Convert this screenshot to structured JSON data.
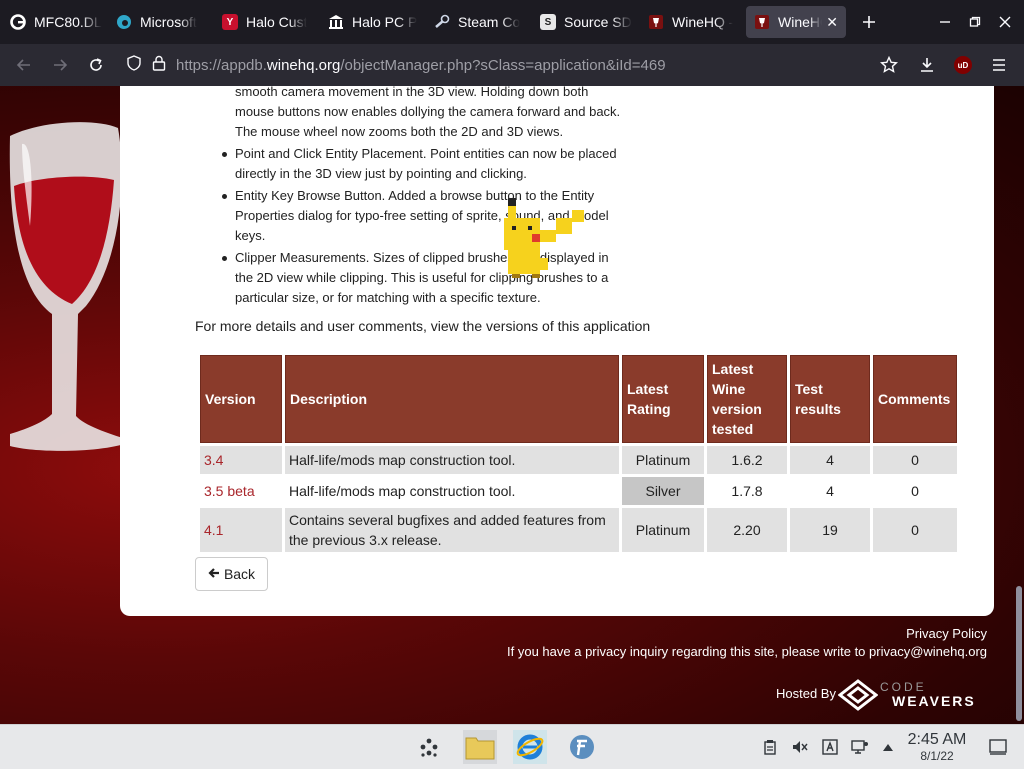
{
  "browser": {
    "tabs": [
      {
        "title": "MFC80.DL",
        "icon": "google-icon",
        "active": false
      },
      {
        "title": "Microsoft",
        "icon": "edge-icon",
        "active": false
      },
      {
        "title": "Halo Cust",
        "icon": "halo-custom-icon",
        "active": false
      },
      {
        "title": "Halo PC P",
        "icon": "institution-icon",
        "active": false
      },
      {
        "title": "Steam Co",
        "icon": "steam-icon",
        "active": false
      },
      {
        "title": "Source SD",
        "icon": "source-sdk-icon",
        "active": false
      },
      {
        "title": "WineHQ -",
        "icon": "winehq-icon",
        "active": false
      },
      {
        "title": "WineHQ",
        "icon": "winehq-icon",
        "active": true
      }
    ],
    "url": {
      "scheme": "https://",
      "sub": "appdb.",
      "host": "winehq.org",
      "path": "/objectManager.php?sClass=application&iId=469"
    },
    "ublock_label": "uD"
  },
  "page": {
    "features": [
      {
        "text": "smooth camera movement in the 3D view. Holding down both mouse buttons now enables dollying the camera forward and back. The mouse wheel now zooms both the 2D and 3D views."
      },
      {
        "text": "Point and Click Entity Placement. Point entities can now be placed directly in the 3D view just by pointing and clicking."
      },
      {
        "text": "Entity Key Browse Button. Added a browse button to the Entity Properties dialog for typo-free setting of sprite, sound, and model keys."
      },
      {
        "text": "Clipper Measurements. Sizes of clipped brushes are displayed in the 2D view while clipping. This is useful for clipping brushes to a particular size, or for matching with a specific texture."
      }
    ],
    "more_details": "For more details and user comments, view the versions of this application",
    "table": {
      "headers": [
        "Version",
        "Description",
        "Latest Rating",
        "Latest Wine version tested",
        "Test results",
        "Comments"
      ],
      "rows": [
        {
          "version": "3.4",
          "description": "Half-life/mods map construction tool.",
          "rating": "Platinum",
          "wine": "1.6.2",
          "tests": "4",
          "comments": "0"
        },
        {
          "version": "3.5 beta",
          "description": "Half-life/mods map construction tool.",
          "rating": "Silver",
          "wine": "1.7.8",
          "tests": "4",
          "comments": "0"
        },
        {
          "version": "4.1",
          "description": "Contains several bugfixes and added features from the previous 3.x release.",
          "rating": "Platinum",
          "wine": "2.20",
          "tests": "19",
          "comments": "0"
        }
      ]
    },
    "back_label": "Back",
    "footer": {
      "privacy_policy": "Privacy Policy",
      "privacy_inquiry": "If you have a privacy inquiry regarding this site, please write to privacy@winehq.org",
      "hosted_by": "Hosted By",
      "codeweavers_top": "CODE",
      "codeweavers_bottom": "WEAVERS"
    }
  },
  "taskbar": {
    "time": "2:45 AM",
    "date": "8/1/22"
  },
  "colors": {
    "header_bg": "#8a3b2b",
    "link": "#a9262b",
    "row_alt": "#e1e1e1"
  }
}
